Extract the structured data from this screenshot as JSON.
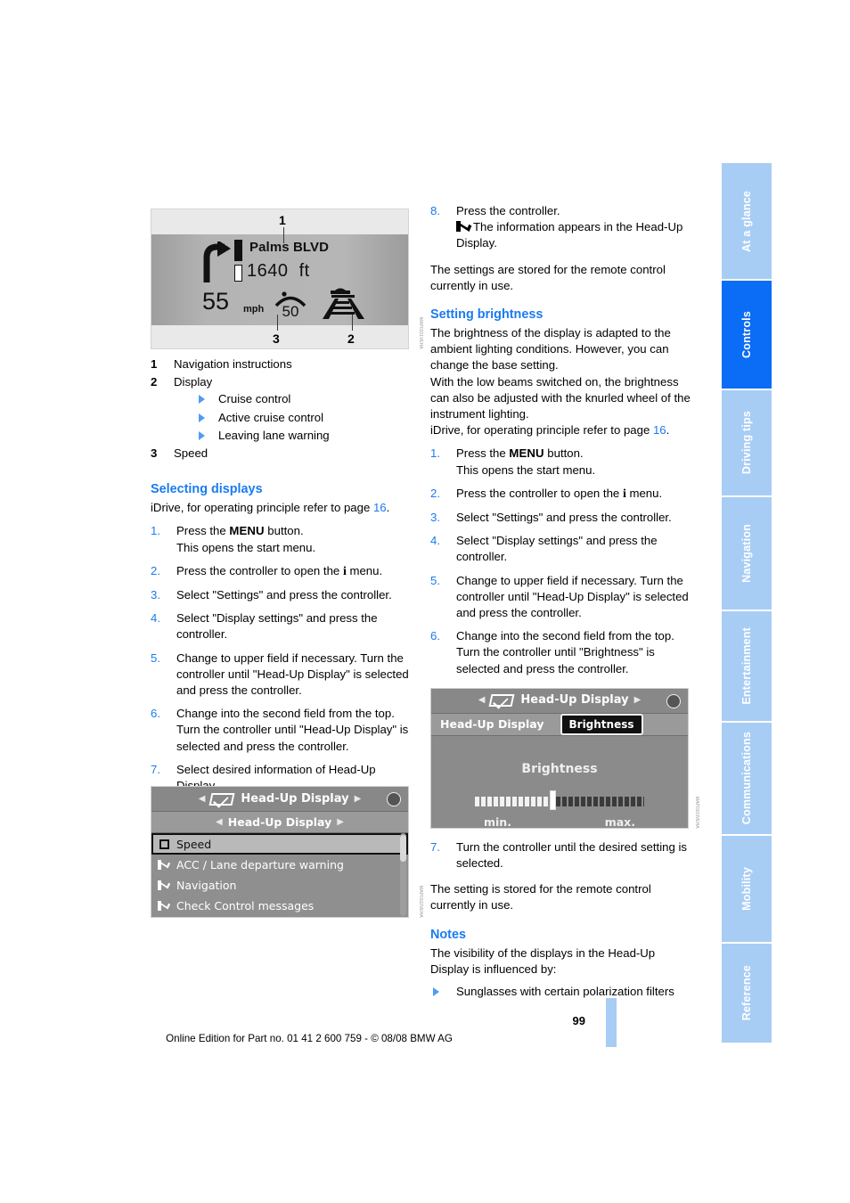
{
  "page": {
    "number": "99",
    "footer": "Online Edition for Part no. 01 41 2 600 759 - © 08/08 BMW AG"
  },
  "tabs": [
    {
      "label": "At a glance",
      "active": false
    },
    {
      "label": "Controls",
      "active": true
    },
    {
      "label": "Driving tips",
      "active": false
    },
    {
      "label": "Navigation",
      "active": false
    },
    {
      "label": "Entertainment",
      "active": false
    },
    {
      "label": "Communications",
      "active": false
    },
    {
      "label": "Mobility",
      "active": false
    },
    {
      "label": "Reference",
      "active": false
    }
  ],
  "hud_figure": {
    "callouts": {
      "one": "1",
      "two": "2",
      "three": "3"
    },
    "street": "Palms BLVD",
    "distance": "1640",
    "distance_unit": "ft",
    "speed": "55",
    "speed_unit": "mph",
    "acc_speed": "50",
    "code": "MAP0101VEHA"
  },
  "legend": {
    "items": [
      {
        "num": "1",
        "label": "Navigation instructions"
      },
      {
        "num": "2",
        "label": "Display"
      },
      {
        "num": "3",
        "label": "Speed"
      }
    ],
    "display_sub": [
      "Cruise control",
      "Active cruise control",
      "Leaving lane warning"
    ]
  },
  "selecting_displays": {
    "heading": "Selecting displays",
    "intro_pre": "iDrive, for operating principle refer to page ",
    "intro_page": "16",
    "intro_post": ".",
    "steps": [
      {
        "num": "1.",
        "pre": "Press the ",
        "key": "MENU",
        "post": " button.",
        "second_line": "This opens the start menu."
      },
      {
        "num": "2.",
        "pre": "Press the controller to open the ",
        "key_i": "i",
        "post": " menu.",
        "second_line": ""
      },
      {
        "num": "3.",
        "text": "Select \"Settings\" and press the controller."
      },
      {
        "num": "4.",
        "text": "Select \"Display settings\" and press the controller."
      },
      {
        "num": "5.",
        "text": "Change to upper field if necessary. Turn the controller until \"Head-Up Display\" is selected and press the controller."
      },
      {
        "num": "6.",
        "text": "Change into the second field from the top. Turn the controller until \"Head-Up Display\" is selected and press the controller."
      },
      {
        "num": "7.",
        "text": "Select desired information of Head-Up Display."
      }
    ]
  },
  "idrive_figure": {
    "top_title": "Head-Up Display",
    "sub_title": "Head-Up Display",
    "rows": [
      {
        "label": "Speed",
        "checked": false,
        "selected": true
      },
      {
        "label": "ACC / Lane departure warning",
        "checked": true,
        "selected": false
      },
      {
        "label": "Navigation",
        "checked": true,
        "selected": false
      },
      {
        "label": "Check Control messages",
        "checked": true,
        "selected": false
      }
    ],
    "code": "MAP0102VEHA"
  },
  "right_column": {
    "step8": {
      "num": "8.",
      "line1": "Press the controller.",
      "line2": "The information appears in the Head-Up Display."
    },
    "stored_note": "The settings are stored for the remote control currently in use.",
    "setting_brightness": {
      "heading": "Setting brightness",
      "para1": "The brightness of the display is adapted to the ambient lighting conditions. However, you can change the base setting.",
      "para2": "With the low beams switched on, the brightness can also be adjusted with the knurled wheel of the instrument lighting.",
      "intro_pre": "iDrive, for operating principle refer to page ",
      "intro_page": "16",
      "intro_post": ".",
      "steps": [
        {
          "num": "1.",
          "pre": "Press the ",
          "key": "MENU",
          "post": " button.",
          "second_line": "This opens the start menu."
        },
        {
          "num": "2.",
          "pre": "Press the controller to open the ",
          "key_i": "i",
          "post": " menu.",
          "second_line": ""
        },
        {
          "num": "3.",
          "text": "Select \"Settings\" and press the controller."
        },
        {
          "num": "4.",
          "text": "Select \"Display settings\" and press the controller."
        },
        {
          "num": "5.",
          "text": "Change to upper field if necessary. Turn the controller until \"Head-Up Display\" is selected and press the controller."
        },
        {
          "num": "6.",
          "text": "Change into the second field from the top. Turn the controller until \"Brightness\" is selected and press the controller."
        }
      ],
      "step7": {
        "num": "7.",
        "text": "Turn the controller until the desired setting is selected."
      },
      "stored_note": "The setting is stored for the remote control currently in use."
    },
    "notes": {
      "heading": "Notes",
      "intro": "The visibility of the displays in the Head-Up Display is influenced by:",
      "bullets": [
        "Sunglasses with certain polarization filters"
      ]
    }
  },
  "brightness_figure": {
    "top_title": "Head-Up Display",
    "tab_left": "Head-Up Display",
    "tab_active": "Brightness",
    "title": "Brightness",
    "min_label": "min.",
    "max_label": "max.",
    "code": "MAP0103VEHA"
  },
  "colors": {
    "accent_blue": "#1a7bf0",
    "tab_blue": "#a8cdf5",
    "tab_active_blue": "#0b6cf5"
  }
}
